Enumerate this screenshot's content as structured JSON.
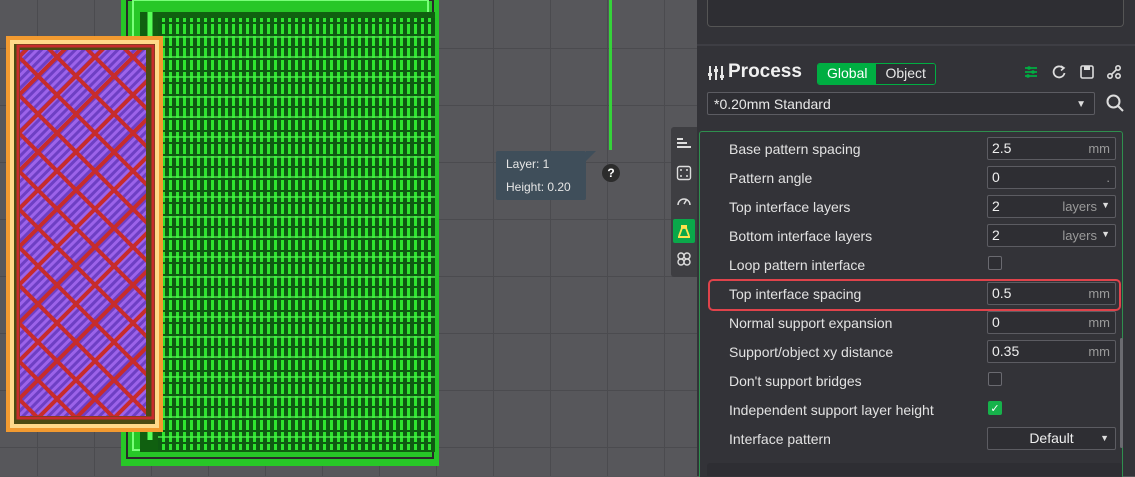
{
  "viewport": {
    "tooltip": {
      "layer": "Layer: 1",
      "height": "Height: 0.20"
    },
    "help_icon": "?",
    "side_toolbar": [
      {
        "icon": "layers-icon",
        "active": false
      },
      {
        "icon": "support-paint-icon",
        "active": false
      },
      {
        "icon": "speed-gauge-icon",
        "active": false
      },
      {
        "icon": "support-tree-icon",
        "active": true
      },
      {
        "icon": "seam-icon",
        "active": false
      }
    ]
  },
  "process": {
    "title": "Process",
    "tabs": {
      "global": "Global",
      "object": "Object"
    },
    "header_icons": [
      "compare-icon",
      "reset-icon",
      "save-icon",
      "settings-icon"
    ],
    "preset": "*0.20mm Standard",
    "search_icon": "search-icon"
  },
  "settings": {
    "rows": [
      {
        "label": "Base pattern spacing",
        "value": "2.5",
        "unit": "mm"
      },
      {
        "label": "Pattern angle",
        "value": "0",
        "unit": "."
      },
      {
        "label": "Top interface layers",
        "value": "2",
        "unit": "layers"
      },
      {
        "label": "Bottom interface layers",
        "value": "2",
        "unit": "layers"
      },
      {
        "label": "Loop pattern interface",
        "checked": false
      },
      {
        "label": "Top interface spacing",
        "value": "0.5",
        "unit": "mm"
      },
      {
        "label": "Normal support expansion",
        "value": "0",
        "unit": "mm"
      },
      {
        "label": "Support/object xy distance",
        "value": "0.35",
        "unit": "mm"
      },
      {
        "label": "Don't support bridges",
        "checked": false
      },
      {
        "label": "Independent support layer height",
        "checked": true
      },
      {
        "label": "Interface pattern",
        "value": "Default"
      }
    ]
  },
  "colors": {
    "accent": "#00ae42",
    "highlight": "#e0434b",
    "support": "#35d33a",
    "model": "#8b4fd6"
  }
}
